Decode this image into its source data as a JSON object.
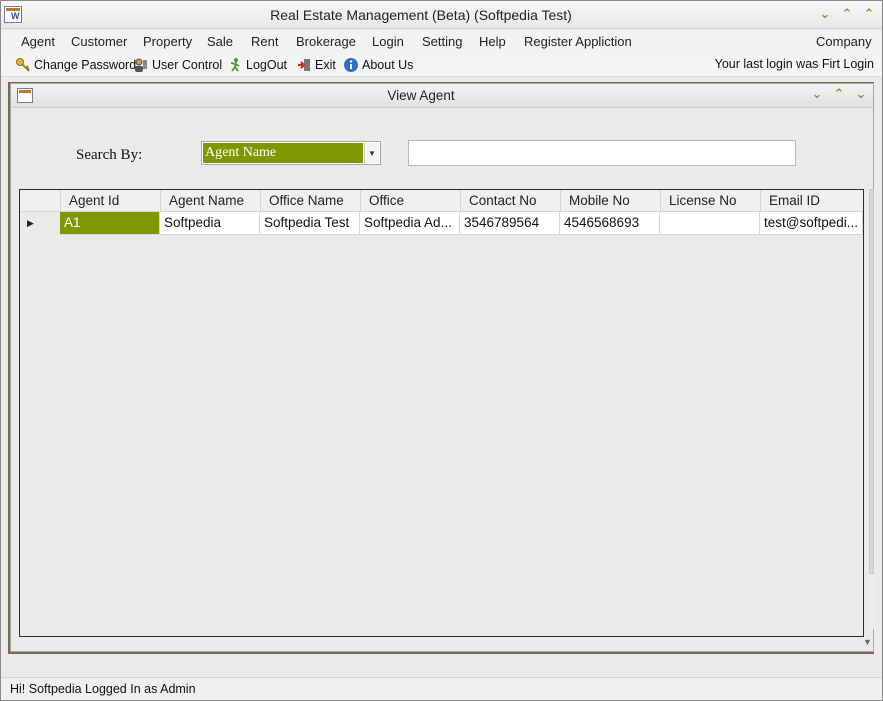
{
  "window": {
    "title": "Real Estate Management (Beta) (Softpedia Test)",
    "accent_color": "#7f9800"
  },
  "menubar": {
    "items": [
      "Agent",
      "Customer",
      "Property",
      "Sale",
      "Rent",
      "Brokerage",
      "Login",
      "Setting",
      "Help",
      "Register Appliction"
    ],
    "right_item": "Company"
  },
  "toolbar": {
    "items": [
      {
        "label": "Change Password",
        "icon": "key-icon"
      },
      {
        "label": "User Control",
        "icon": "user-control-icon"
      },
      {
        "label": "LogOut",
        "icon": "logout-icon"
      },
      {
        "label": "Exit",
        "icon": "exit-icon"
      },
      {
        "label": "About Us",
        "icon": "info-icon"
      }
    ],
    "login_info": "Your last login was Firt Login"
  },
  "view_agent": {
    "title": "View Agent",
    "search_label": "Search By:",
    "search_by_value": "Agent Name",
    "search_text": ""
  },
  "grid": {
    "columns": [
      "Agent Id",
      "Agent Name",
      "Office Name",
      "Office",
      "Contact No",
      "Mobile No",
      "License No",
      "Email ID"
    ],
    "rows": [
      [
        "A1",
        "Softpedia",
        "Softpedia Test",
        "Softpedia Ad...",
        "3546789564",
        "4546568693",
        "",
        "test@softpedi..."
      ]
    ]
  },
  "statusbar": {
    "text": "Hi! Softpedia  Logged In as Admin"
  }
}
